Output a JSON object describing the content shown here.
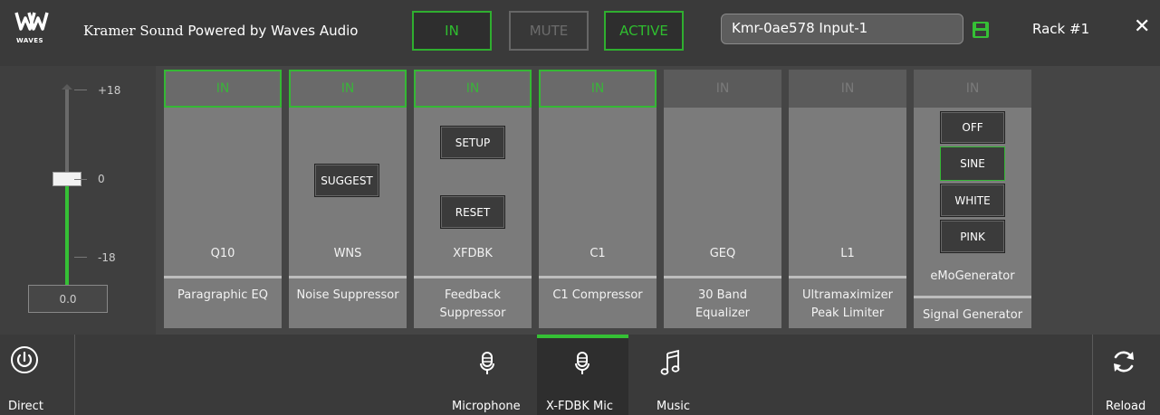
{
  "header": {
    "logo_text": "WAVES",
    "title_kramer": "Kramer Sound",
    "title_rest": "Powered by Waves Audio",
    "in_label": "IN",
    "mute_label": "MUTE",
    "active_label": "ACTIVE",
    "input_name": "Kmr-0ae578 Input-1",
    "rack_label": "Rack",
    "rack_number": "#1",
    "close_glyph": "✕",
    "accent_color": "#35c035"
  },
  "fader": {
    "top_label": "+18",
    "mid_label": "0",
    "bottom_label": "-18",
    "value": "0.0",
    "level_db": 0
  },
  "plugins": [
    {
      "in_label": "IN",
      "active": true,
      "code": "Q10",
      "name_line1": "Paragraphic EQ",
      "name_line2": ""
    },
    {
      "in_label": "IN",
      "active": true,
      "code": "WNS",
      "name_line1": "Noise Suppressor",
      "name_line2": "",
      "button": "SUGGEST"
    },
    {
      "in_label": "IN",
      "active": true,
      "code": "XFDBK",
      "name_line1": "Feedback",
      "name_line2": "Suppressor",
      "button1": "SETUP",
      "button2": "RESET"
    },
    {
      "in_label": "IN",
      "active": true,
      "code": "C1",
      "name_line1": "C1 Compressor",
      "name_line2": ""
    },
    {
      "in_label": "IN",
      "active": false,
      "code": "GEQ",
      "name_line1": "30 Band",
      "name_line2": "Equalizer"
    },
    {
      "in_label": "IN",
      "active": false,
      "code": "L1",
      "name_line1": "Ultramaximizer",
      "name_line2": "Peak Limiter"
    },
    {
      "in_label": "IN",
      "active": false,
      "code": "eMoGenerator",
      "name_line1": "Signal Generator",
      "name_line2": "",
      "options": [
        "OFF",
        "SINE",
        "WHITE",
        "PINK"
      ],
      "selected": "SINE"
    }
  ],
  "bottom": {
    "direct_label": "Direct",
    "reload_label": "Reload",
    "tabs": [
      {
        "label": "Microphone",
        "icon": "microphone-icon"
      },
      {
        "label": "X-FDBK Mic",
        "icon": "microphone-icon"
      },
      {
        "label": "Music",
        "icon": "music-note-icon"
      }
    ],
    "active_tab": "X-FDBK Mic"
  }
}
